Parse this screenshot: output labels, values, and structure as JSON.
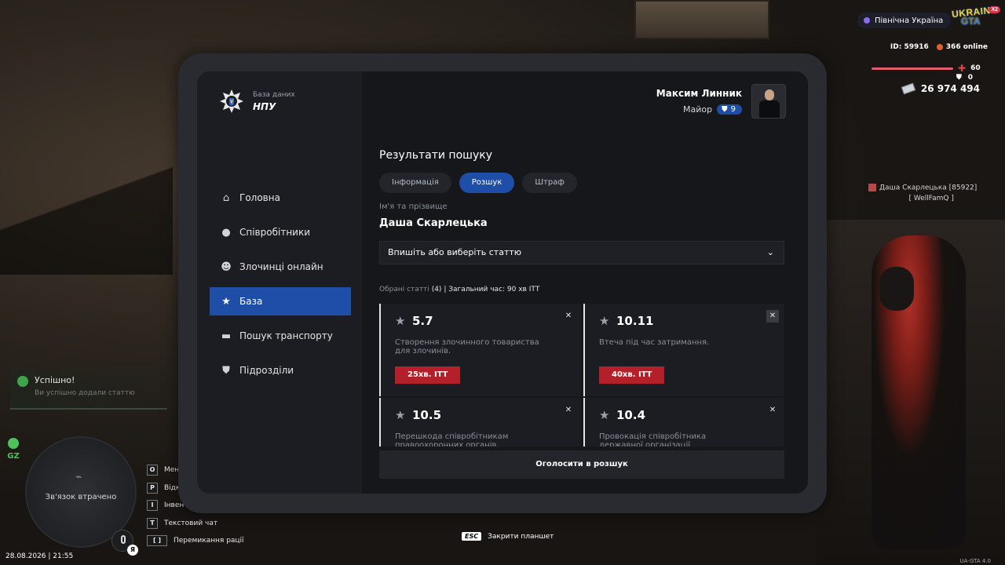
{
  "hud": {
    "server": "Північна Україна",
    "logo_line1": "UKRAINE",
    "logo_line2": "GTA",
    "logo_badge": "X2",
    "id": "ID: 59916",
    "online": "366 online",
    "health": "60",
    "armor": "0",
    "money": "26 974 494",
    "nametag": "Даша Скарлецька [85922]",
    "nametag_sub": "[ WellFamQ ]",
    "notification_title": "Успішно!",
    "notification_text": "Ви успішно додали статтю",
    "gz": "GZ",
    "minimap_status": "Зв'язок втрачено",
    "mic_label": "Я",
    "datetime": "28.08.2026 | 21:55",
    "keys": [
      {
        "key": "O",
        "label": "Меню"
      },
      {
        "key": "P",
        "label": "Відкр"
      },
      {
        "key": "I",
        "label": "Інвент."
      },
      {
        "key": "T",
        "label": "Текстовий чат"
      },
      {
        "key": "[ ]",
        "label": "Перемикання рації"
      }
    ],
    "esc_key": "ESC",
    "esc_label": "Закрити планшет",
    "version": "UA-GTA 4.0"
  },
  "tablet": {
    "brand_small": "База даних",
    "brand_large": "НПУ",
    "nav": [
      {
        "label": "Головна",
        "icon": "home-icon"
      },
      {
        "label": "Співробітники",
        "icon": "users-icon"
      },
      {
        "label": "Злочинці онлайн",
        "icon": "criminal-icon"
      },
      {
        "label": "База",
        "icon": "star-icon",
        "active": true
      },
      {
        "label": "Пошук транспорту",
        "icon": "car-icon"
      },
      {
        "label": "Підрозділи",
        "icon": "shield-icon"
      }
    ],
    "user": {
      "name": "Максим Линник",
      "rank": "Майор",
      "level": "9"
    },
    "section_title": "Результати пошуку",
    "tabs": [
      "Інформація",
      "Розшук",
      "Штраф"
    ],
    "active_tab": "Розшук",
    "name_label": "Ім'я та прізвище",
    "name_value": "Даша Скарлецька",
    "select_placeholder": "Впишіть або виберіть статтю",
    "summary_prefix": "Обрані статті",
    "summary_count": "(4)",
    "summary_total": "| Загальний час: 90 хв ІТТ",
    "articles": [
      {
        "number": "5.7",
        "description": "Створення злочинного товариства для злочинів.",
        "penalty": "25хв. ІТТ"
      },
      {
        "number": "10.11",
        "description": "Втеча під час затримання.",
        "penalty": "40хв. ІТТ"
      },
      {
        "number": "10.5",
        "description": "Перешкода співробітникам правоохоронних органів.",
        "penalty": ""
      },
      {
        "number": "10.4",
        "description": "Провокація співробітника державної організації.",
        "penalty": ""
      }
    ],
    "declare_button": "Оголосити в розшук"
  },
  "colors": {
    "accent": "#1f4ea8",
    "penalty": "#b3202a",
    "panel": "#16171b",
    "sidebar": "#1c1d22"
  }
}
